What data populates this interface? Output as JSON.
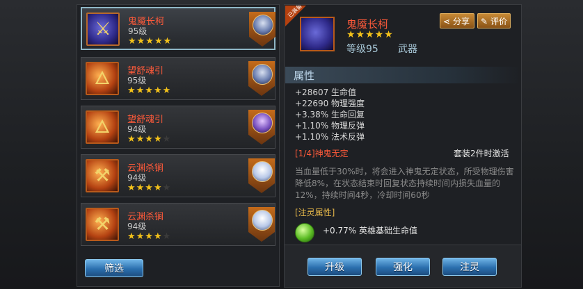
{
  "list": [
    {
      "name": "鬼魇长柯",
      "level": "95级",
      "stars_on": "★★★★★",
      "stars_off": "",
      "hero": "blue"
    },
    {
      "name": "望舒魂引",
      "level": "95级",
      "stars_on": "★★★★★",
      "stars_off": "",
      "hero": "blue"
    },
    {
      "name": "望舒魂引",
      "level": "94级",
      "stars_on": "★★★★",
      "stars_off": "★",
      "hero": "purple"
    },
    {
      "name": "云渊杀锏",
      "level": "94级",
      "stars_on": "★★★★",
      "stars_off": "★",
      "hero": "white"
    },
    {
      "name": "云渊杀锏",
      "level": "94级",
      "stars_on": "★★★★",
      "stars_off": "★",
      "hero": "white"
    }
  ],
  "buttons": {
    "filter": "筛选",
    "upgrade": "升级",
    "enhance": "强化",
    "inject": "注灵"
  },
  "detail": {
    "corner_tag": "已装备",
    "name": "鬼魇长柯",
    "stars": "★★★★★",
    "level": "等级95",
    "type": "武器",
    "share_label": "分享",
    "rate_label": "评价",
    "section_title": "属性",
    "attributes": [
      "+28607 生命值",
      "+22690 物理强度",
      "+3.38% 生命回复",
      "+1.10% 物理反弹",
      "+1.10% 法术反弹"
    ],
    "set_title": "[1/4]神鬼无定",
    "set_condition": "套装2件时激活",
    "set_desc": "当血量低于30%时，将会进入神鬼无定状态，所受物理伤害降低8%，在状态结束时回复状态持续时间内损失血量的12%，持续时间4秒，冷却时间60秒",
    "inject_title": "[注灵属性]",
    "inject_value": "+0.77% 英雄基础生命值"
  }
}
